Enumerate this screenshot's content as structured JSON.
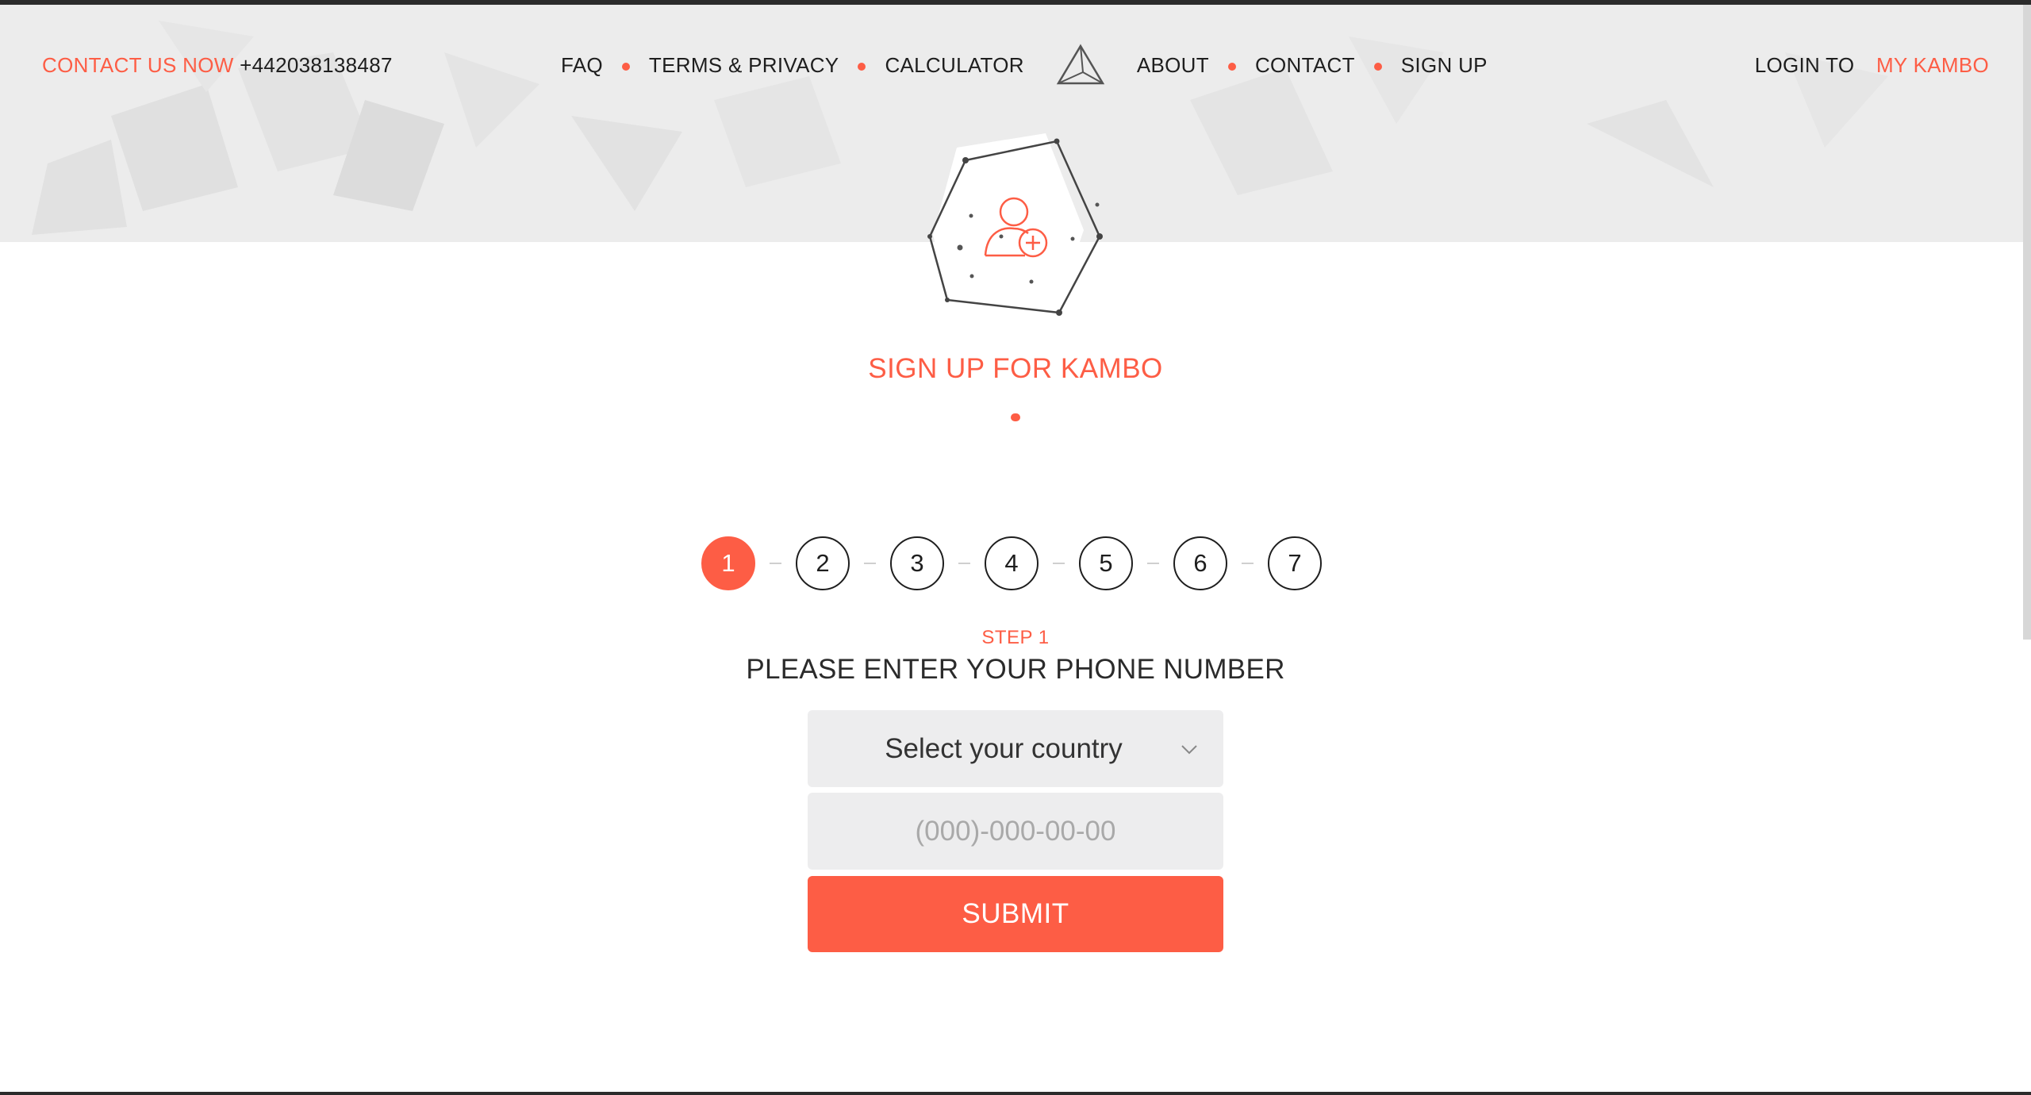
{
  "header": {
    "contact_label": "CONTACT US NOW",
    "contact_phone": "+442038138487",
    "nav_left": [
      "FAQ",
      "TERMS & PRIVACY",
      "CALCULATOR"
    ],
    "nav_right": [
      "ABOUT",
      "CONTACT",
      "SIGN UP"
    ],
    "login_label": "LOGIN TO",
    "login_link": "MY KAMBO"
  },
  "main": {
    "title": "SIGN UP FOR KAMBO",
    "steps": [
      "1",
      "2",
      "3",
      "4",
      "5",
      "6",
      "7"
    ],
    "active_step": 1,
    "step_label": "STEP 1",
    "step_heading": "PLEASE ENTER YOUR PHONE NUMBER"
  },
  "form": {
    "country_select": "Select your country",
    "phone_placeholder": "(000)-000-00-00",
    "submit_label": "SUBMIT"
  },
  "colors": {
    "accent": "#fd5d45",
    "hero_bg": "#ececec",
    "field_bg": "#ededee"
  },
  "icons": [
    "kambo-logo-icon",
    "add-user-icon",
    "chevron-down-icon"
  ]
}
